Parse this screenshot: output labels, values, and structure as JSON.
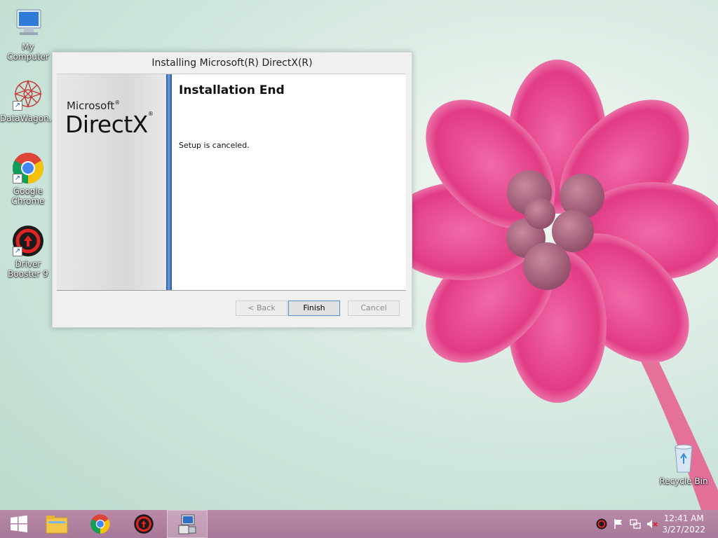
{
  "desktop": {
    "icons": [
      {
        "label": "My Computer",
        "icon": "computer-icon"
      },
      {
        "label": "DataWagon...",
        "icon": "datawagon-icon"
      },
      {
        "label": "Google Chrome",
        "icon": "chrome-icon"
      },
      {
        "label": "Driver Booster 9",
        "icon": "driver-booster-icon"
      },
      {
        "label": "Recycle Bin",
        "icon": "recycle-bin-icon"
      }
    ]
  },
  "dialog": {
    "title": "Installing Microsoft(R) DirectX(R)",
    "brand_small": "Microsoft",
    "brand_large": "DirectX",
    "brand_reg": "®",
    "heading": "Installation End",
    "message": "Setup is canceled.",
    "buttons": {
      "back": "< Back",
      "finish": "Finish",
      "cancel": "Cancel"
    }
  },
  "taskbar": {
    "items": [
      "start-icon",
      "file-explorer-icon",
      "chrome-icon",
      "driver-booster-icon",
      "directx-setup-icon"
    ],
    "clock": {
      "time": "12:41 AM",
      "date": "3/27/2022"
    },
    "colors": {
      "accent": "#b98aa8"
    }
  }
}
